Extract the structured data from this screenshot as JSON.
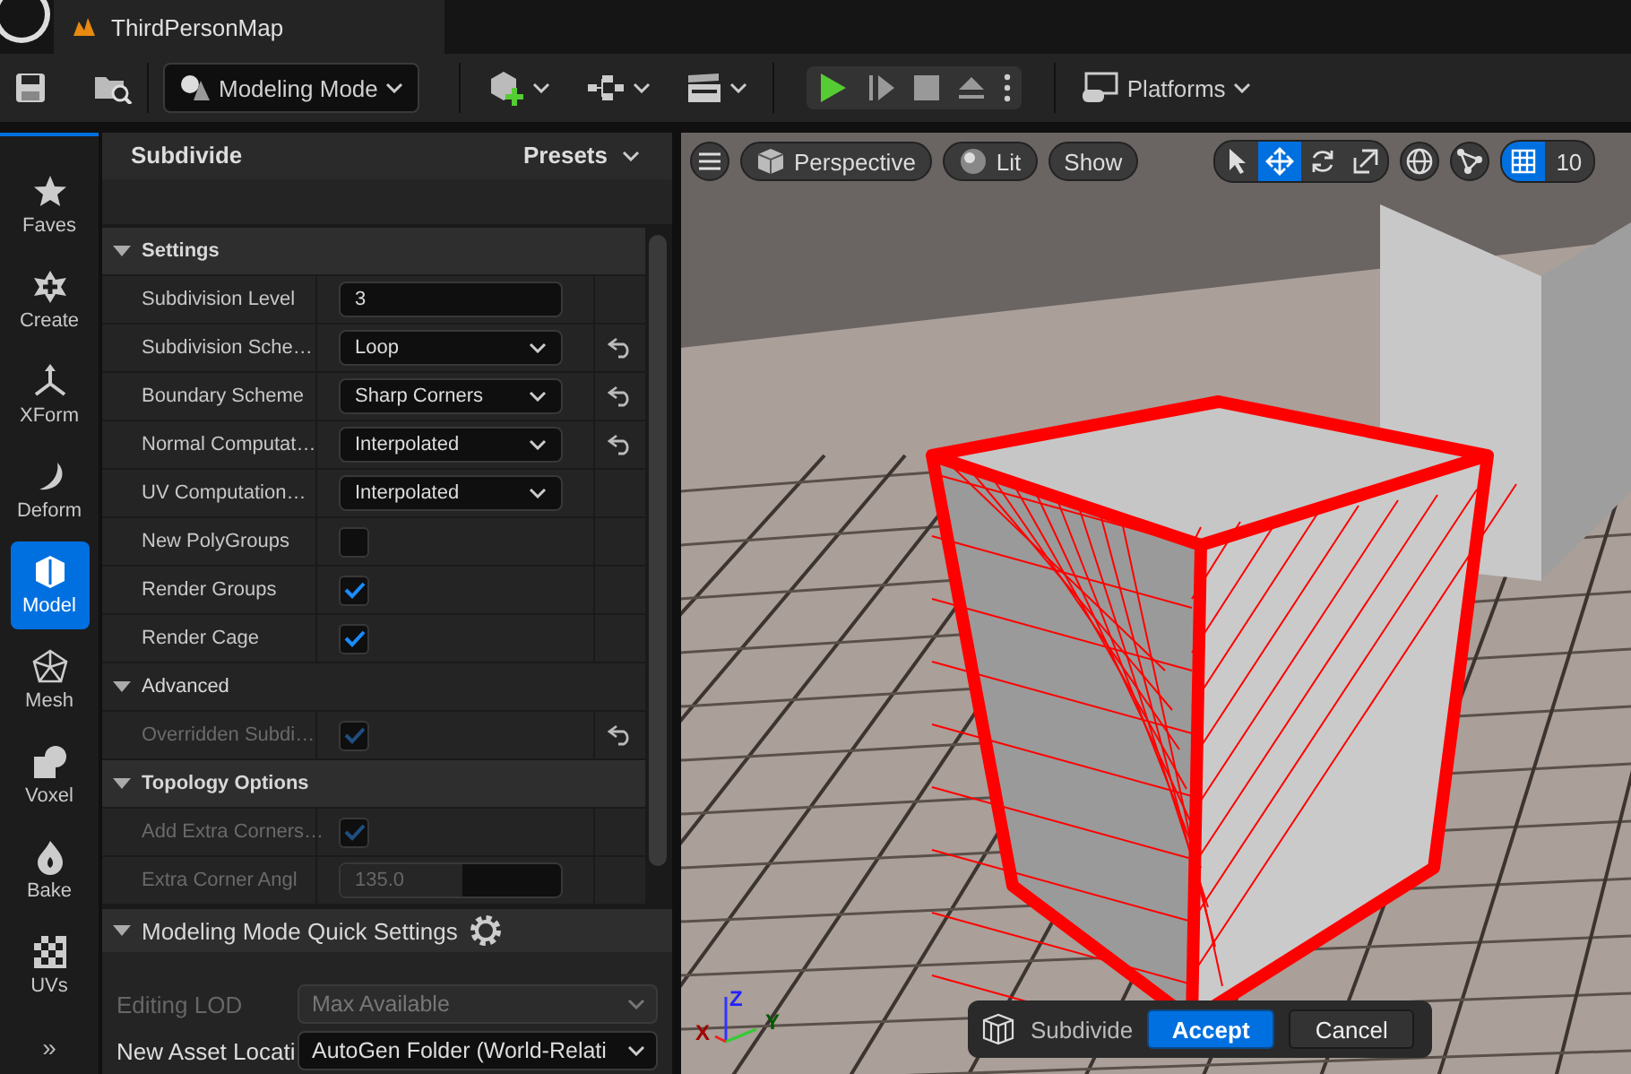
{
  "title_bar": {
    "tab": "ThirdPersonMap"
  },
  "toolbar": {
    "mode": "Modeling Mode",
    "platforms": "Platforms"
  },
  "mode_palette": {
    "items": [
      {
        "label": "Faves",
        "selected": false
      },
      {
        "label": "Create",
        "selected": false
      },
      {
        "label": "XForm",
        "selected": false
      },
      {
        "label": "Deform",
        "selected": false
      },
      {
        "label": "Model",
        "selected": true
      },
      {
        "label": "Mesh",
        "selected": false
      },
      {
        "label": "Voxel",
        "selected": false
      },
      {
        "label": "Bake",
        "selected": false
      },
      {
        "label": "UVs",
        "selected": false
      }
    ],
    "more": "»"
  },
  "tool_panel": {
    "title": "Subdivide",
    "presets": "Presets",
    "sections": [
      {
        "title": "Settings",
        "kind": "category",
        "expanded": true,
        "rows": [
          {
            "label": "Subdivision Level",
            "kind": "number",
            "value": "3",
            "reset": false,
            "disabled": false
          },
          {
            "label": "Subdivision Sche…",
            "kind": "dropdown",
            "value": "Loop",
            "reset": true,
            "disabled": false
          },
          {
            "label": "Boundary Scheme",
            "kind": "dropdown",
            "value": "Sharp Corners",
            "reset": true,
            "disabled": false
          },
          {
            "label": "Normal Computat…",
            "kind": "dropdown",
            "value": "Interpolated",
            "reset": true,
            "disabled": false
          },
          {
            "label": "UV Computation…",
            "kind": "dropdown",
            "value": "Interpolated",
            "reset": false,
            "disabled": false
          },
          {
            "label": "New PolyGroups",
            "kind": "checkbox",
            "checked": false,
            "reset": false,
            "disabled": false
          },
          {
            "label": "Render Groups",
            "kind": "checkbox",
            "checked": true,
            "reset": false,
            "disabled": false
          },
          {
            "label": "Render Cage",
            "kind": "checkbox",
            "checked": true,
            "reset": false,
            "disabled": false
          }
        ]
      },
      {
        "title": "Advanced",
        "kind": "subcategory",
        "expanded": true,
        "rows": [
          {
            "label": "Overridden Subdi…",
            "kind": "checkbox",
            "checked": true,
            "reset": true,
            "disabled": true
          }
        ]
      },
      {
        "title": "Topology Options",
        "kind": "category",
        "expanded": true,
        "rows": [
          {
            "label": "Add Extra Corners…",
            "kind": "checkbox",
            "checked": true,
            "reset": false,
            "disabled": true
          },
          {
            "label": "Extra Corner Angl",
            "kind": "slider",
            "value": "135.0",
            "level": 0.55,
            "reset": false,
            "disabled": true
          }
        ]
      }
    ]
  },
  "quick_settings": {
    "title": "Modeling Mode Quick Settings",
    "expanded": true,
    "rows": [
      {
        "label": "Editing LOD",
        "value": "Max Available",
        "disabled": true
      },
      {
        "label": "New Asset Locati",
        "value": "AutoGen Folder (World-Relati",
        "disabled": false
      }
    ]
  },
  "viewport": {
    "view": "Perspective",
    "lighting": "Lit",
    "show": "Show",
    "tools": [
      {
        "selected": false
      },
      {
        "selected": true
      },
      {
        "selected": false
      },
      {
        "selected": false
      }
    ],
    "grid": {
      "on": true,
      "value": "10"
    },
    "axes": {
      "x": "X",
      "y": "Y",
      "z": "Z"
    },
    "accept_bar": {
      "tool": "Subdivide",
      "accept": "Accept",
      "cancel": "Cancel"
    }
  }
}
